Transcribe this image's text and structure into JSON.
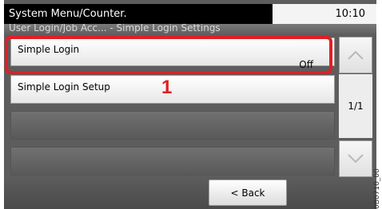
{
  "header": {
    "title": "System Menu/Counter.",
    "clock": "10:10",
    "breadcrumb": "User Login/Job Acc... - Simple Login Settings"
  },
  "menu": {
    "items": [
      {
        "label": "Simple Login",
        "value": "Off"
      },
      {
        "label": "Simple Login Setup",
        "value": ""
      }
    ]
  },
  "pager": {
    "page": "1/1",
    "up_icon": "chevron-up-icon",
    "down_icon": "chevron-down-icon"
  },
  "footer": {
    "back_label": "< Back"
  },
  "annotation": {
    "callout": "1",
    "highlight_color": "#e21e26",
    "figure_code": "0B0710_00"
  }
}
